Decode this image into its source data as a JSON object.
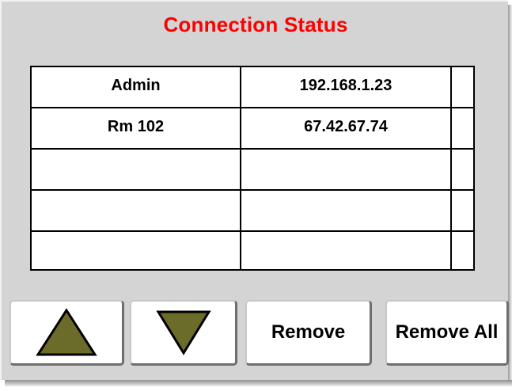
{
  "title": "Connection Status",
  "colors": {
    "title": "#ff0000",
    "panel_background": "#d4d4d4",
    "arrow_fill": "#6b6b2a"
  },
  "connections": [
    {
      "name": "Admin",
      "ip": "192.168.1.23",
      "extra": ""
    },
    {
      "name": "Rm 102",
      "ip": "67.42.67.74",
      "extra": ""
    },
    {
      "name": "",
      "ip": "",
      "extra": ""
    },
    {
      "name": "",
      "ip": "",
      "extra": ""
    },
    {
      "name": "",
      "ip": "",
      "extra": ""
    }
  ],
  "buttons": {
    "up_icon": "up-triangle-icon",
    "down_icon": "down-triangle-icon",
    "remove_label": "Remove",
    "remove_all_label": "Remove All"
  }
}
